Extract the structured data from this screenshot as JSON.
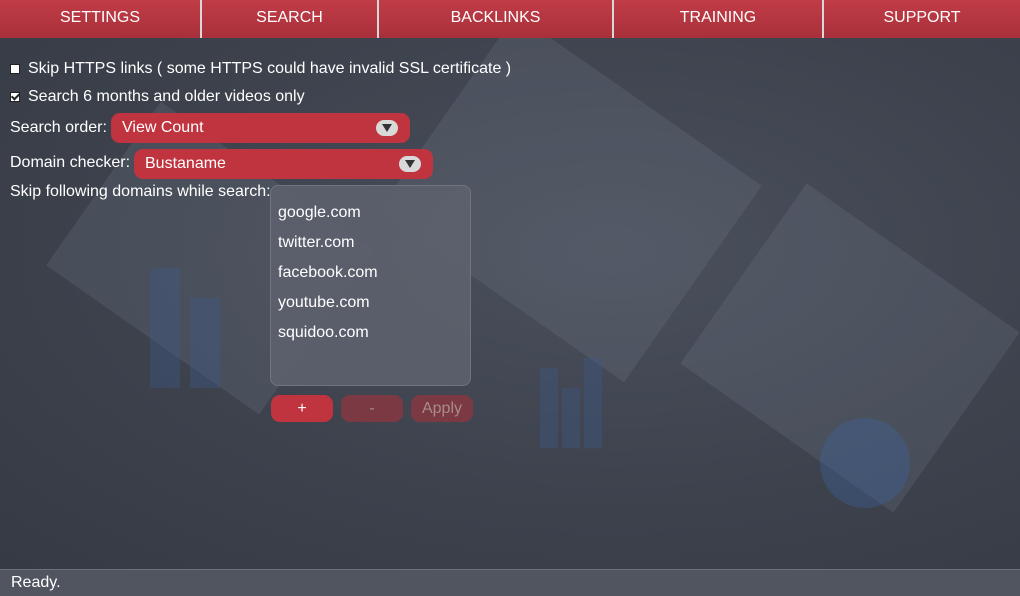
{
  "nav": {
    "tabs": [
      {
        "label": "SETTINGS"
      },
      {
        "label": "SEARCH"
      },
      {
        "label": "BACKLINKS"
      },
      {
        "label": "TRAINING"
      },
      {
        "label": "SUPPORT"
      }
    ]
  },
  "options": {
    "skip_https": {
      "label": "Skip HTTPS links ( some HTTPS could have invalid SSL certificate )",
      "checked": false
    },
    "old_videos": {
      "label": "Search 6 months and older videos only",
      "checked": true
    }
  },
  "search_order": {
    "label": "Search order:",
    "value": "View Count"
  },
  "domain_checker": {
    "label": "Domain checker:",
    "value": "Bustaname"
  },
  "skip_domains": {
    "label": "Skip following domains while search:",
    "items": [
      "google.com",
      "twitter.com",
      "facebook.com",
      "youtube.com",
      "squidoo.com"
    ]
  },
  "buttons": {
    "add": "+",
    "remove": "-",
    "apply": "Apply"
  },
  "status": {
    "text": "Ready."
  },
  "colors": {
    "accent": "#c0343f",
    "background": "#3c414c",
    "status_bar": "#505560"
  },
  "icons": {
    "dropdown": "chevron-down-icon",
    "checkbox": "checkbox-icon"
  }
}
